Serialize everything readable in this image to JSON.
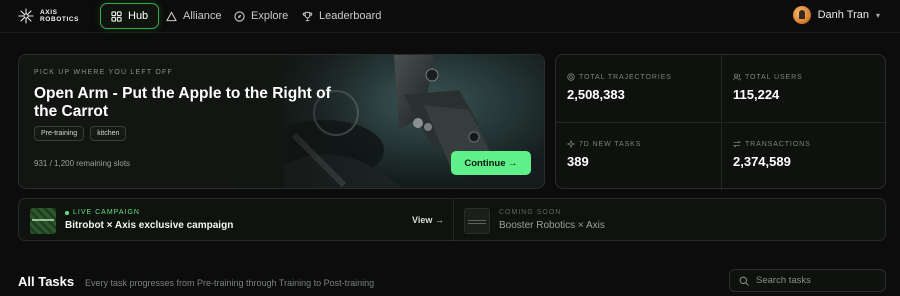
{
  "brand": {
    "name": "AXIS\nROBOTICS",
    "accent": "#5ff08a",
    "icon": "sparkle-logo-icon"
  },
  "nav": {
    "items": [
      {
        "label": "Hub",
        "icon": "grid-icon",
        "active": true
      },
      {
        "label": "Alliance",
        "icon": "triangle-icon",
        "active": false
      },
      {
        "label": "Explore",
        "icon": "compass-icon",
        "active": false
      },
      {
        "label": "Leaderboard",
        "icon": "trophy-icon",
        "active": false
      }
    ]
  },
  "user": {
    "name": "Danh Tran",
    "avatar_icon": "user-avatar",
    "menu_icon": "caret-down-icon",
    "caret": "▾"
  },
  "hero": {
    "kicker": "PICK UP WHERE YOU LEFT OFF",
    "title": "Open Arm - Put the Apple to the Right of the Carrot",
    "tags": [
      "Pre-training",
      "kitchen"
    ],
    "slots": "931 / 1,200 remaining slots",
    "cta": "Continue →"
  },
  "stats": [
    {
      "label": "TOTAL TRAJECTORIES",
      "value": "2,508,383",
      "icon": "target-icon"
    },
    {
      "label": "TOTAL USERS",
      "value": "115,224",
      "icon": "users-icon"
    },
    {
      "label": "7D NEW TASKS",
      "value": "389",
      "icon": "sparkle-icon"
    },
    {
      "label": "TRANSACTIONS",
      "value": "2,374,589",
      "icon": "swap-icon"
    }
  ],
  "campaign": {
    "live_label": "LIVE CAMPAIGN",
    "live_title": "Bitrobot × Axis exclusive campaign",
    "view": "View →",
    "soon_label": "COMING SOON",
    "soon_title": "Booster Robotics × Axis"
  },
  "tasks": {
    "title": "All Tasks",
    "subtitle": "Every task progresses from Pre-training through Training to Post-training",
    "search_placeholder": "Search tasks"
  }
}
